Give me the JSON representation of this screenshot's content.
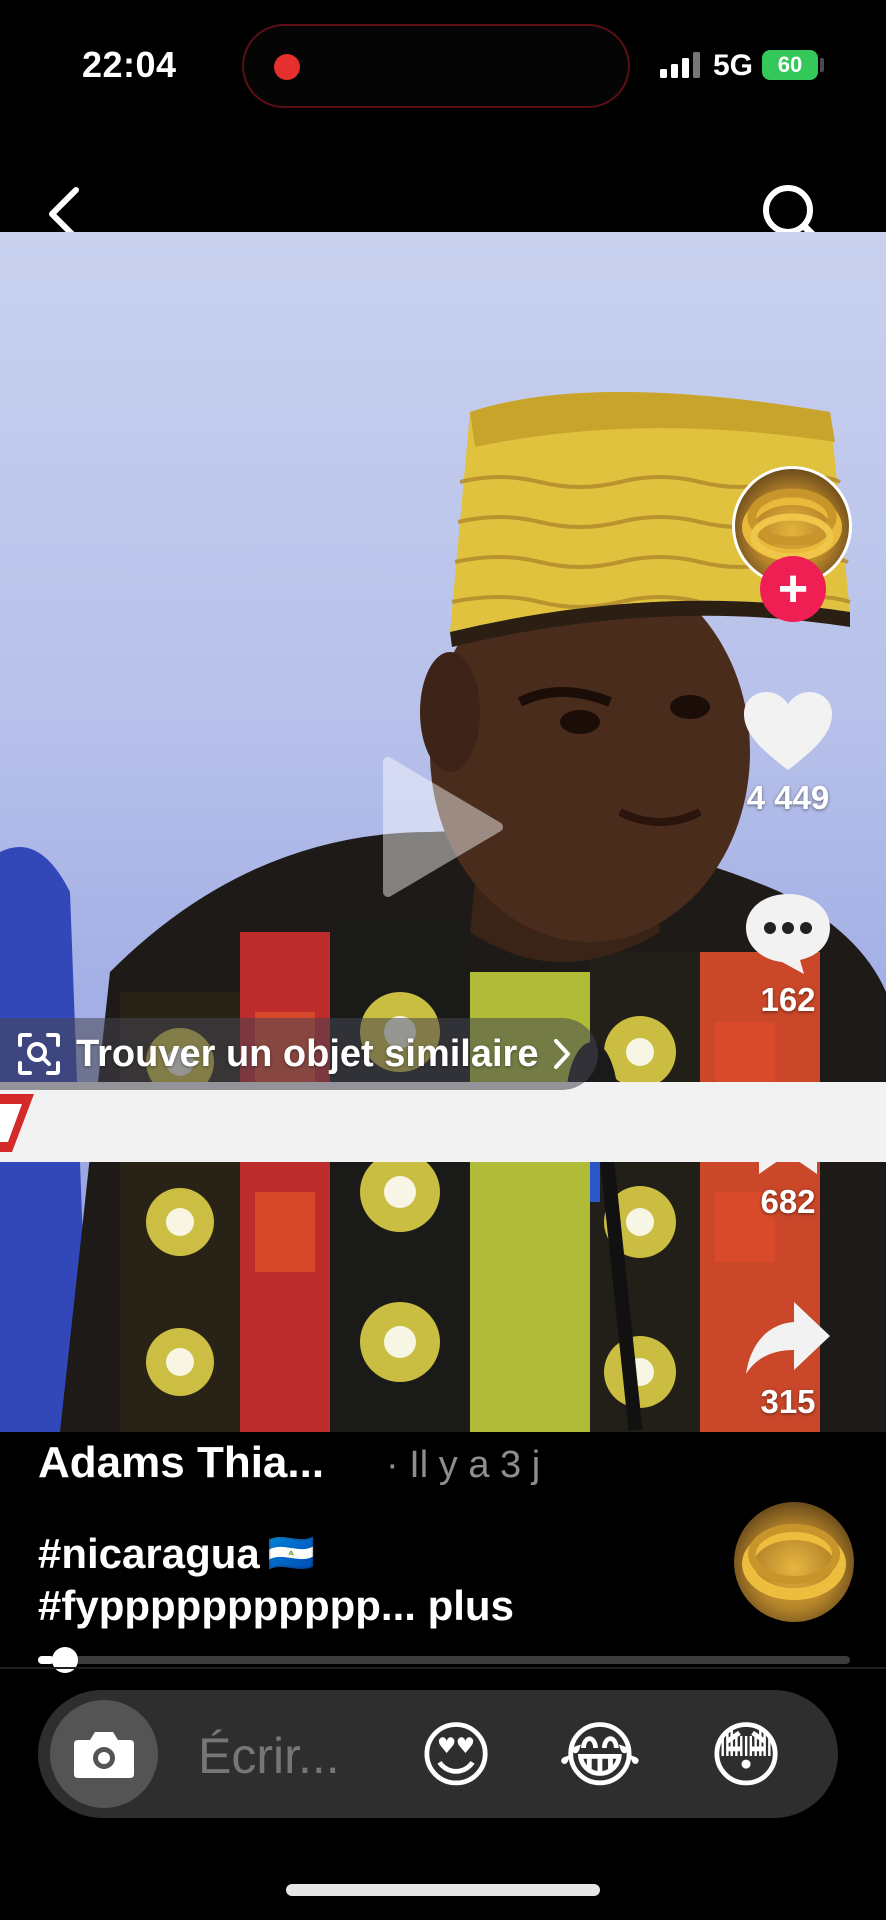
{
  "status_bar": {
    "time": "22:04",
    "network": "5G",
    "battery": "60"
  },
  "video": {
    "visual_search_label": "Trouver un objet similaire",
    "playing": false
  },
  "rail": {
    "likes": "4 449",
    "comments": "162",
    "saves": "682",
    "shares": "315"
  },
  "post": {
    "author": "Adams Thia...",
    "time": "· Il y a 3 j",
    "caption_line1": "#nicaragua",
    "caption_flag": "🇳🇮",
    "caption_line2": "#fyppppppppppp... plus",
    "progress": 0.02
  },
  "comment_bar": {
    "placeholder": "Écrir...",
    "emojis": [
      "😍",
      "😂",
      "😳"
    ]
  },
  "colors": {
    "accent": "#ef1f54",
    "recording": "#e5302f",
    "battery": "#34c759"
  },
  "icons": [
    "back-icon",
    "search-icon",
    "heart-icon",
    "comment-icon",
    "bookmark-icon",
    "share-icon",
    "camera-icon",
    "play-icon",
    "visual-search-icon"
  ]
}
